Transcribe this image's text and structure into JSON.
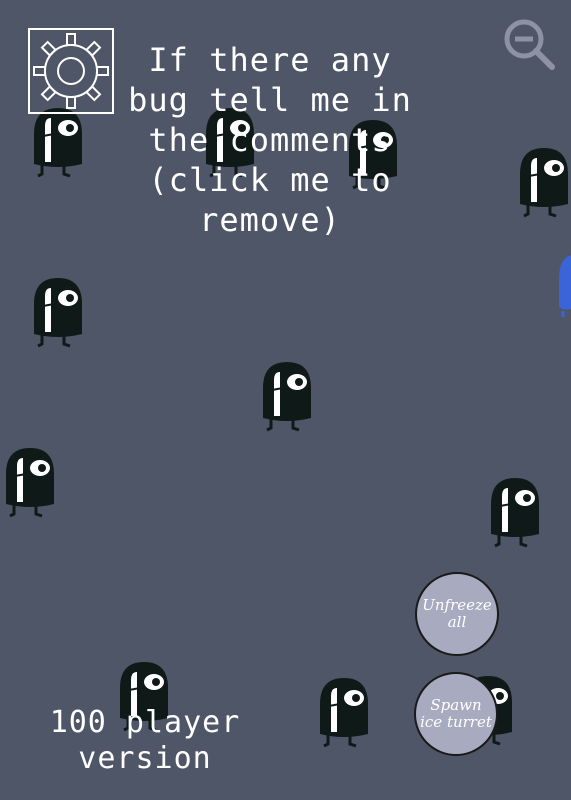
{
  "notice": {
    "text": "If there any\nbug tell me in\nthe comments\n(click me to\nremove)"
  },
  "version_label": "100 player\nversion",
  "buttons": {
    "unfreeze_all": "Unfreeze\nall",
    "spawn_ice_turret": "Spawn\nice turret"
  },
  "icons": {
    "settings": "gear-icon",
    "zoom": "zoom-out-icon"
  },
  "colors": {
    "background": "#4f5667",
    "player_body": "#0f1a18",
    "button_fill": "#a8aabf",
    "other_player": "#3a64d8"
  }
}
